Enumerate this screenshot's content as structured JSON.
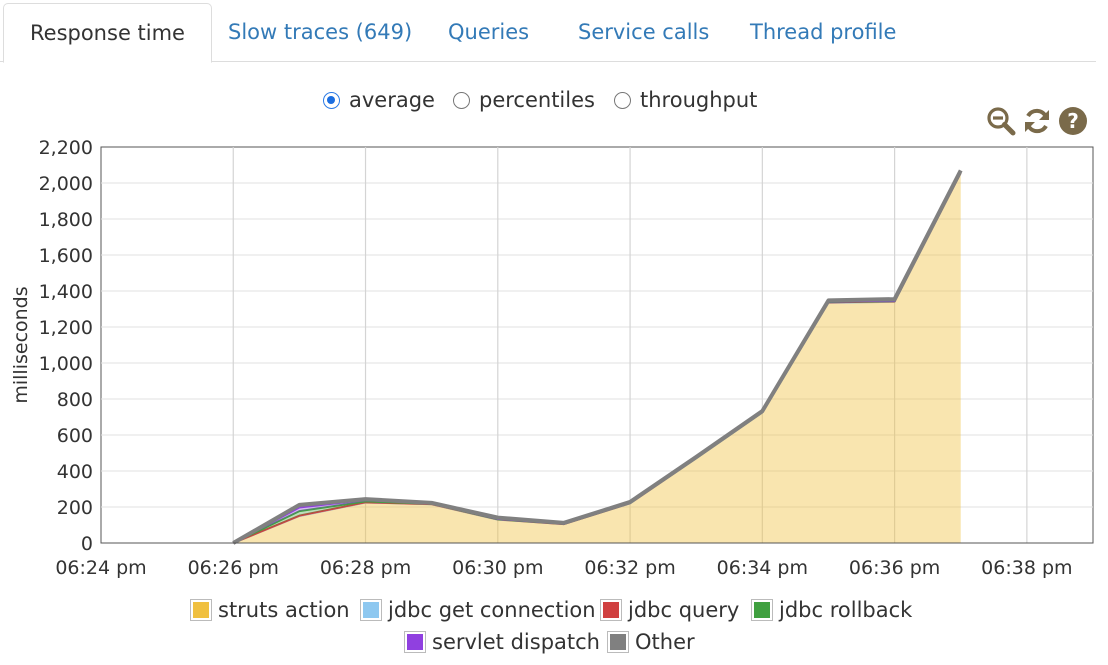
{
  "tabs": [
    {
      "label": "Response time",
      "active": true
    },
    {
      "label": "Slow traces (649)",
      "active": false
    },
    {
      "label": "Queries",
      "active": false
    },
    {
      "label": "Service calls",
      "active": false
    },
    {
      "label": "Thread profile",
      "active": false
    }
  ],
  "view_options": [
    {
      "label": "average",
      "checked": true
    },
    {
      "label": "percentiles",
      "checked": false
    },
    {
      "label": "throughput",
      "checked": false
    }
  ],
  "toolbar": {
    "icons": [
      "zoom-out-icon",
      "refresh-icon",
      "help-icon"
    ],
    "icon_color": "#7a6a4a"
  },
  "chart_data": {
    "type": "area",
    "stacked": true,
    "ylabel": "milliseconds",
    "xlabel": "",
    "x_tick_labels": [
      "06:24 pm",
      "06:26 pm",
      "06:28 pm",
      "06:30 pm",
      "06:32 pm",
      "06:34 pm",
      "06:36 pm",
      "06:38 pm"
    ],
    "x_domain_minutes": [
      0,
      15
    ],
    "y_ticks": [
      0,
      200,
      400,
      600,
      800,
      1000,
      1200,
      1400,
      1600,
      1800,
      2000,
      2200
    ],
    "y_tick_labels": [
      "0",
      "200",
      "400",
      "600",
      "800",
      "1,000",
      "1,200",
      "1,400",
      "1,600",
      "1,800",
      "2,000",
      "2,200"
    ],
    "ylim": [
      0,
      2200
    ],
    "grid": true,
    "legend_position": "bottom",
    "x": [
      "06:26 pm",
      "06:27 pm",
      "06:28 pm",
      "06:29 pm",
      "06:30 pm",
      "06:31 pm",
      "06:32 pm",
      "06:33 pm",
      "06:34 pm",
      "06:35 pm",
      "06:36 pm",
      "06:37 pm"
    ],
    "x_minutes": [
      2,
      3,
      4,
      5,
      6,
      7,
      8,
      9,
      10,
      11,
      12,
      13
    ],
    "series": [
      {
        "name": "struts action",
        "color": "#f0c040",
        "values": [
          0,
          150,
          225,
          215,
          130,
          105,
          220,
          470,
          725,
          1335,
          1340,
          2055
        ]
      },
      {
        "name": "jdbc get connection",
        "color": "#8ec8f0",
        "values": [
          0,
          0,
          0,
          0,
          0,
          0,
          0,
          0,
          0,
          0,
          0,
          0
        ]
      },
      {
        "name": "jdbc query",
        "color": "#d04040",
        "values": [
          0,
          2,
          1,
          1,
          1,
          0,
          1,
          1,
          1,
          2,
          2,
          2
        ]
      },
      {
        "name": "jdbc rollback",
        "color": "#40a040",
        "values": [
          0,
          25,
          5,
          2,
          1,
          1,
          1,
          1,
          1,
          2,
          2,
          2
        ]
      },
      {
        "name": "servlet dispatch",
        "color": "#9040e0",
        "values": [
          0,
          20,
          8,
          2,
          2,
          1,
          1,
          1,
          1,
          2,
          2,
          2
        ]
      },
      {
        "name": "Other",
        "color": "#808080",
        "values": [
          0,
          15,
          5,
          3,
          7,
          5,
          5,
          5,
          5,
          7,
          9,
          9
        ]
      }
    ]
  }
}
